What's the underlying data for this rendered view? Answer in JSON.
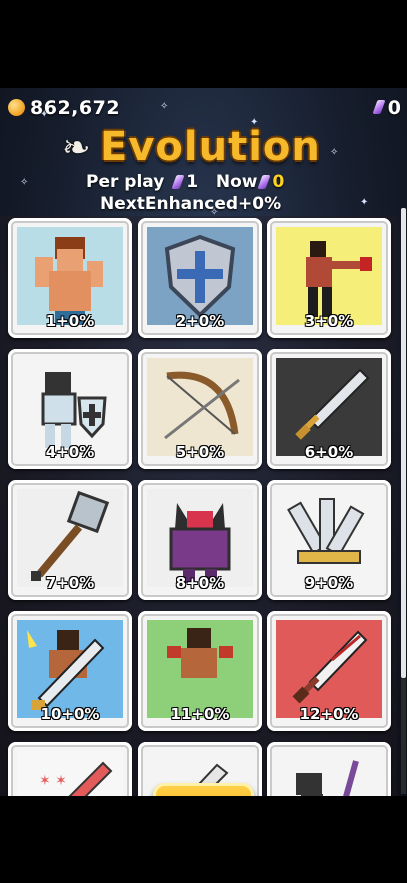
{
  "header": {
    "coins": "862,672",
    "gems": "0",
    "title": "Evolution",
    "per_play_label": "Per play",
    "per_play_value": "1",
    "now_label": "Now",
    "now_value": "0",
    "next_enhanced": "NextEnhanced+0%"
  },
  "items": [
    {
      "label": "1+0%",
      "icon": "muscle-man-icon"
    },
    {
      "label": "2+0%",
      "icon": "shield-icon"
    },
    {
      "label": "3+0%",
      "icon": "boxer-icon"
    },
    {
      "label": "4+0%",
      "icon": "knight-shield-icon"
    },
    {
      "label": "5+0%",
      "icon": "bow-icon"
    },
    {
      "label": "6+0%",
      "icon": "sword-icon"
    },
    {
      "label": "7+0%",
      "icon": "mace-icon"
    },
    {
      "label": "8+0%",
      "icon": "demon-armor-icon"
    },
    {
      "label": "9+0%",
      "icon": "swords-bundle-icon"
    },
    {
      "label": "10+0%",
      "icon": "warrior-sword-icon"
    },
    {
      "label": "11+0%",
      "icon": "warrior-icon"
    },
    {
      "label": "12+0%",
      "icon": "red-sword-icon"
    },
    {
      "label": "",
      "icon": "blood-blade-icon"
    },
    {
      "label": "",
      "icon": "dagger-icon"
    },
    {
      "label": "",
      "icon": "staff-hero-icon"
    }
  ],
  "confirm": {
    "icon": "check-icon",
    "symbol": "✔"
  },
  "colors": {
    "title": "#f6b92b",
    "coin": "#f0a020",
    "gem": "#b57cf0",
    "button": "#f5a312"
  }
}
